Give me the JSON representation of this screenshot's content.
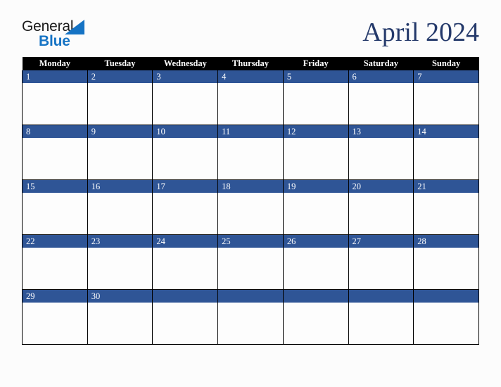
{
  "brand": {
    "name_part1": "General",
    "name_part2": "Blue",
    "triangle_icon": "blue-triangle-icon",
    "primary_color": "#1573c4",
    "text_color": "#1b1b1b"
  },
  "header": {
    "title": "April 2024",
    "title_color": "#24396a"
  },
  "calendar": {
    "month": "April",
    "year": "2024",
    "header_bg": "#000000",
    "header_text_color": "#ffffff",
    "day_bar_color": "#2f5596",
    "day_text_color": "#ffffff",
    "cell_bg": "#fdfdfd",
    "grid_color": "#000000",
    "weekday_headers": [
      "Monday",
      "Tuesday",
      "Wednesday",
      "Thursday",
      "Friday",
      "Saturday",
      "Sunday"
    ],
    "weeks": [
      [
        "1",
        "2",
        "3",
        "4",
        "5",
        "6",
        "7"
      ],
      [
        "8",
        "9",
        "10",
        "11",
        "12",
        "13",
        "14"
      ],
      [
        "15",
        "16",
        "17",
        "18",
        "19",
        "20",
        "21"
      ],
      [
        "22",
        "23",
        "24",
        "25",
        "26",
        "27",
        "28"
      ],
      [
        "29",
        "30",
        "",
        "",
        "",
        "",
        ""
      ]
    ]
  }
}
